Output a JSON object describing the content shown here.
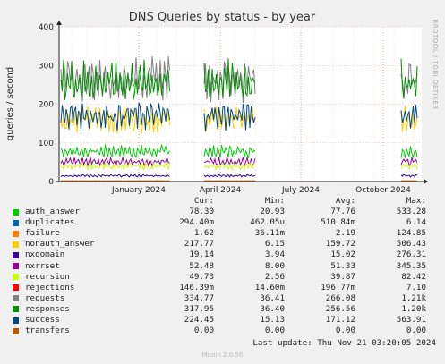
{
  "chart_data": {
    "type": "line",
    "title": "DNS Queries by status - by year",
    "ylabel": "queries / second",
    "side_label": "RRDTOOL / TOBI OETIKER",
    "ylim": [
      0,
      400
    ],
    "y_ticks": [
      0,
      100,
      200,
      300,
      400
    ],
    "x_ticks": [
      "January 2024",
      "April 2024",
      "July 2024",
      "October 2024"
    ],
    "columns": [
      "Cur:",
      "Min:",
      "Avg:",
      "Max:"
    ],
    "series": [
      {
        "name": "auth_answer",
        "color": "#00cc00",
        "cur": "78.30",
        "min": "20.93",
        "avg": "77.76",
        "max": "533.28"
      },
      {
        "name": "duplicates",
        "color": "#0066b3",
        "cur": "294.40m",
        "min": "462.05u",
        "avg": "510.84m",
        "max": "6.14"
      },
      {
        "name": "failure",
        "color": "#ff8000",
        "cur": "1.62",
        "min": "36.11m",
        "avg": "2.19",
        "max": "124.85"
      },
      {
        "name": "nonauth_answer",
        "color": "#ffcc00",
        "cur": "217.77",
        "min": "6.15",
        "avg": "159.72",
        "max": "506.43"
      },
      {
        "name": "nxdomain",
        "color": "#330099",
        "cur": "19.14",
        "min": "3.94",
        "avg": "15.02",
        "max": "276.31"
      },
      {
        "name": "nxrrset",
        "color": "#990099",
        "cur": "52.48",
        "min": "8.00",
        "avg": "51.33",
        "max": "345.35"
      },
      {
        "name": "recursion",
        "color": "#ccff00",
        "cur": "49.73",
        "min": "2.56",
        "avg": "39.87",
        "max": "82.42"
      },
      {
        "name": "rejections",
        "color": "#ff0000",
        "cur": "146.39m",
        "min": "14.60m",
        "avg": "196.77m",
        "max": "7.10"
      },
      {
        "name": "requests",
        "color": "#808080",
        "cur": "334.77",
        "min": "36.41",
        "avg": "266.08",
        "max": "1.21k"
      },
      {
        "name": "responses",
        "color": "#008f00",
        "cur": "317.95",
        "min": "36.40",
        "avg": "256.56",
        "max": "1.20k"
      },
      {
        "name": "success",
        "color": "#00487d",
        "cur": "224.45",
        "min": "15.13",
        "avg": "171.12",
        "max": "563.91"
      },
      {
        "name": "transfers",
        "color": "#b35a00",
        "cur": "0.00",
        "min": "0.00",
        "avg": "0.00",
        "max": "0.00"
      }
    ]
  },
  "last_update": "Last update: Thu Nov 21 03:20:05 2024",
  "footer": "Munin 2.0.56"
}
